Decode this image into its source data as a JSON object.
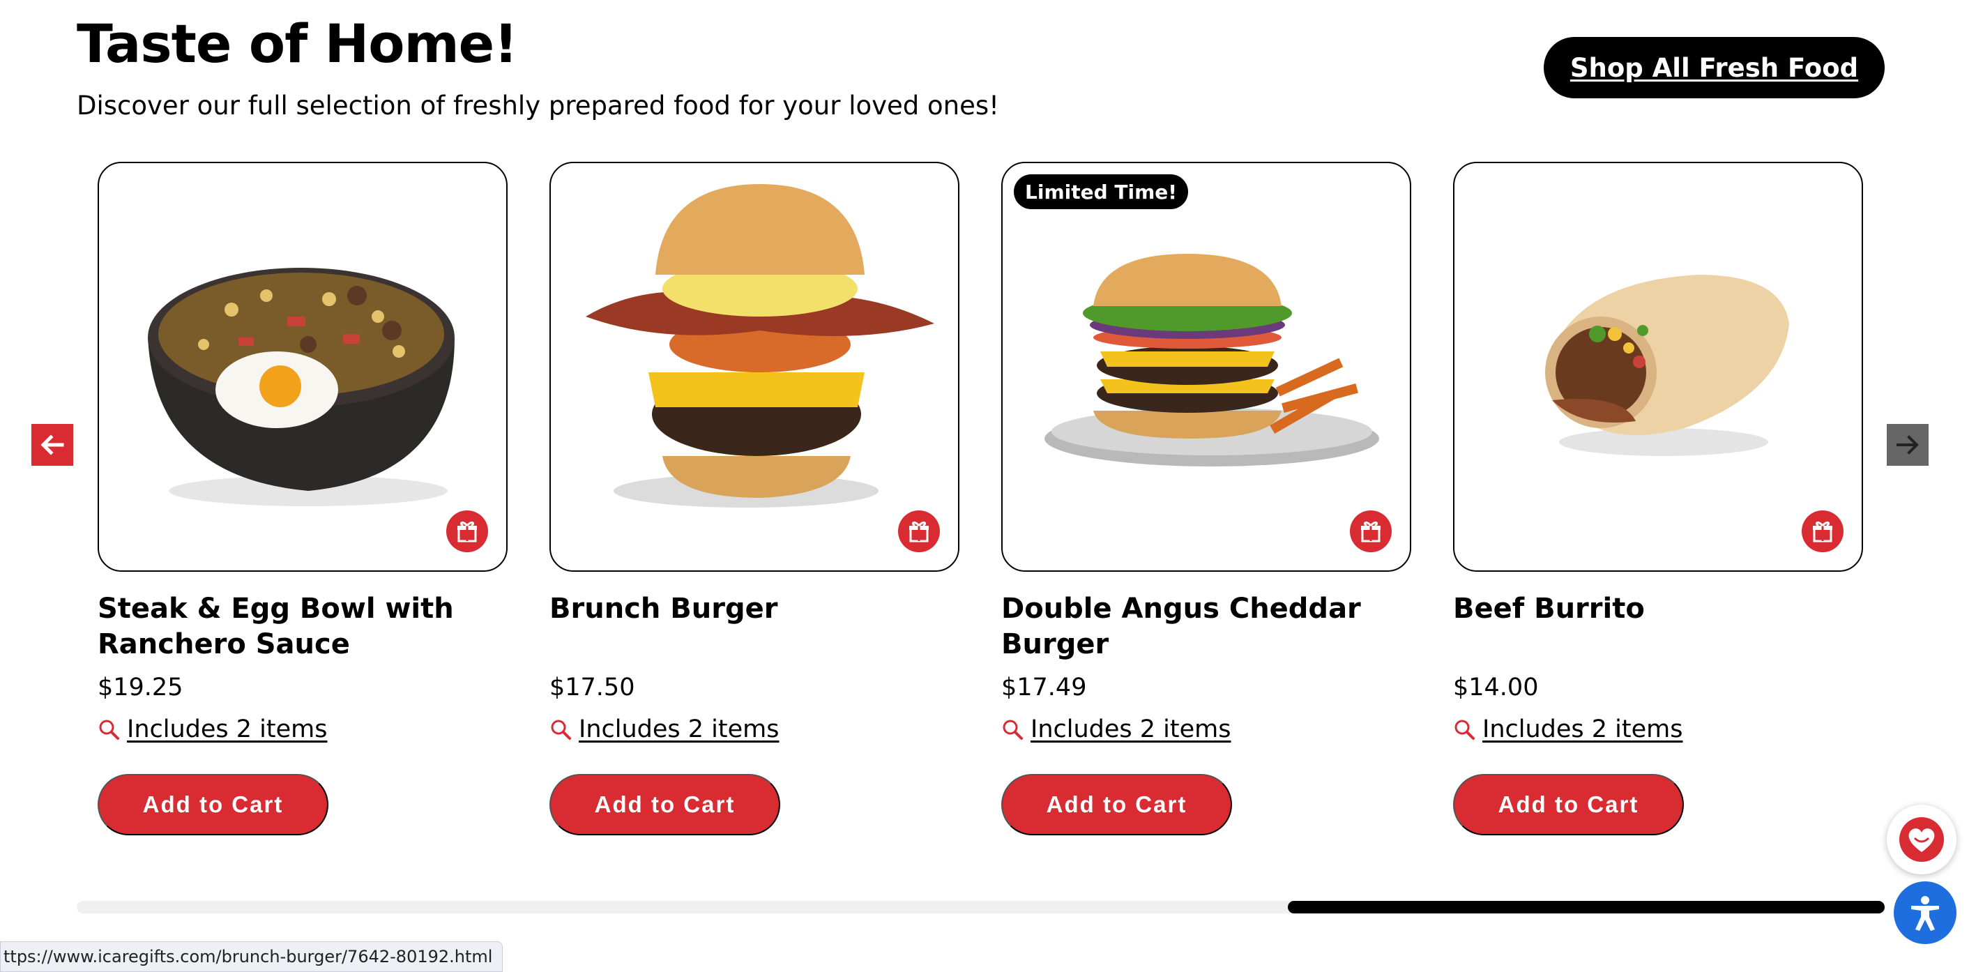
{
  "header": {
    "title": "Taste of Home!",
    "subtitle": "Discover our full selection of freshly prepared food for your loved ones!",
    "shop_all_label": "Shop All Fresh Food"
  },
  "products": [
    {
      "title": "Steak & Egg Bowl with Ranchero Sauce",
      "price": "$19.25",
      "includes": "Includes 2 items",
      "cta": "Add to Cart",
      "badge": ""
    },
    {
      "title": "Brunch Burger",
      "price": "$17.50",
      "includes": "Includes 2 items",
      "cta": "Add to Cart",
      "badge": ""
    },
    {
      "title": "Double Angus Cheddar Burger",
      "price": "$17.49",
      "includes": "Includes 2 items",
      "cta": "Add to Cart",
      "badge": "Limited Time!"
    },
    {
      "title": "Beef Burrito",
      "price": "$14.00",
      "includes": "Includes 2 items",
      "cta": "Add to Cart",
      "badge": ""
    }
  ],
  "carousel": {
    "scroll_position_fraction": 0.67
  },
  "status_bar": {
    "url": "ttps://www.icaregifts.com/brunch-burger/7642-80192.html"
  },
  "colors": {
    "accent_red": "#d82b32",
    "black": "#000000",
    "accessibility_blue": "#1f6ee0",
    "arrow_gray": "#666666"
  },
  "icons": [
    "arrow-left-icon",
    "arrow-right-icon",
    "gift-icon",
    "search-icon",
    "heart-icon",
    "accessibility-icon"
  ]
}
